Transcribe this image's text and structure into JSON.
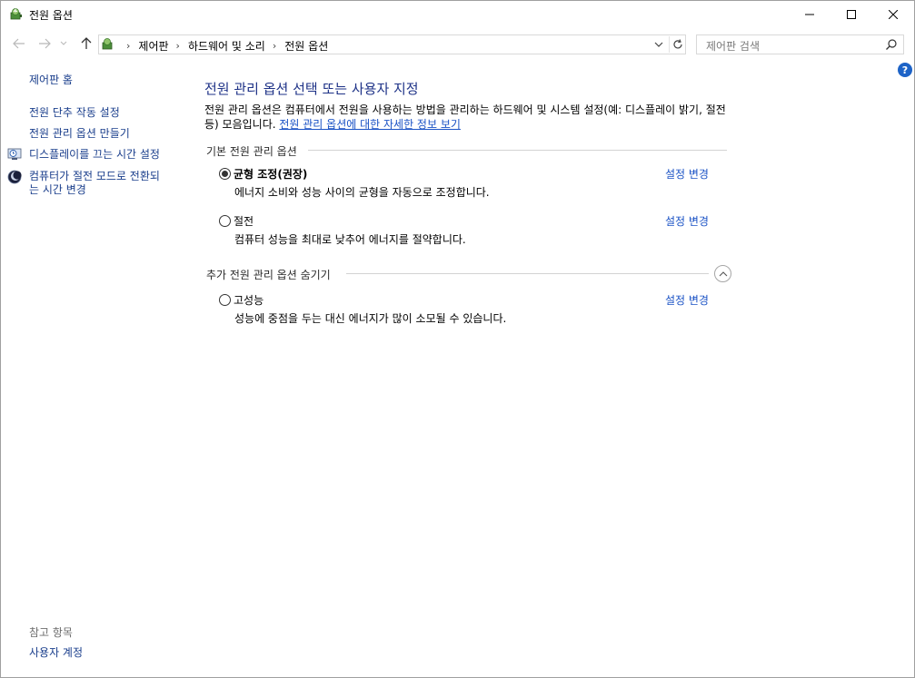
{
  "window": {
    "title": "전원 옵션"
  },
  "address": {
    "crumbs": [
      "제어판",
      "하드웨어 및 소리",
      "전원 옵션"
    ],
    "search_placeholder": "제어판 검색"
  },
  "sidebar": {
    "home": "제어판 홈",
    "items": [
      "전원 단추 작동 설정",
      "전원 관리 옵션 만들기",
      "디스플레이를 끄는 시간 설정",
      "컴퓨터가 절전 모드로 전환되는 시간 변경"
    ],
    "item4_line1": "컴퓨터가 절전 모드로 전환되",
    "item4_line2": "는 시간 변경",
    "see_also": "참고 항목",
    "user_accounts": "사용자 계정"
  },
  "main": {
    "title": "전원 관리 옵션 선택 또는 사용자 지정",
    "description": "전원 관리 옵션은 컴퓨터에서 전원을 사용하는 방법을 관리하는 하드웨어 및 시스템 설정(예: 디스플레이 밝기, 절전 등) 모음입니다. ",
    "description_link": "전원 관리 옵션에 대한 자세한 정보 보기",
    "section_basic": "기본 전원 관리 옵션",
    "section_more": "추가 전원 관리 옵션 숨기기",
    "change_label": "설정 변경",
    "plans": [
      {
        "name": "균형 조정(권장)",
        "description": "에너지 소비와 성능 사이의 균형을 자동으로 조정합니다.",
        "selected": true
      },
      {
        "name": "절전",
        "description": "컴퓨터 성능을 최대로 낮추어 에너지를 절약합니다.",
        "selected": false
      },
      {
        "name": "고성능",
        "description": "성능에 중점을 두는 대신 에너지가 많이 소모될 수 있습니다.",
        "selected": false
      }
    ]
  },
  "colors": {
    "link": "#1a52c5",
    "sidebar_link": "#1a3e8c",
    "title": "#1e3287",
    "help": "#1d63c7"
  },
  "icons": [
    "power-options-icon",
    "minimize-icon",
    "maximize-icon",
    "close-icon",
    "back-arrow-icon",
    "forward-arrow-icon",
    "recent-chevron-icon",
    "up-arrow-icon",
    "dropdown-chevron-icon",
    "refresh-icon",
    "search-icon",
    "help-icon",
    "display-clock-icon",
    "sleep-moon-icon",
    "collapse-chevron-icon"
  ]
}
